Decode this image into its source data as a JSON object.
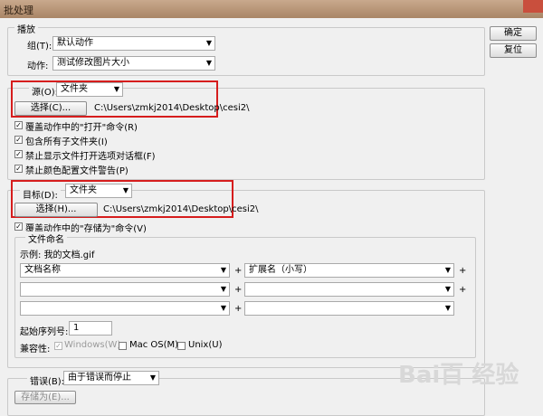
{
  "window": {
    "title": "批处理"
  },
  "buttons": {
    "ok": "确定",
    "reset": "复位"
  },
  "play": {
    "legend": "播放",
    "group_label": "组(T):",
    "group_value": "默认动作",
    "action_label": "动作:",
    "action_value": "测试修改图片大小"
  },
  "source": {
    "label": "源(O):",
    "value": "文件夹",
    "choose_button": "选择(C)...",
    "path": "C:\\Users\\zmkj2014\\Desktop\\cesi2\\",
    "options": [
      {
        "label": "覆盖动作中的\"打开\"命令(R)",
        "checked": true
      },
      {
        "label": "包含所有子文件夹(I)",
        "checked": true
      },
      {
        "label": "禁止显示文件打开选项对话框(F)",
        "checked": true
      },
      {
        "label": "禁止颜色配置文件警告(P)",
        "checked": true
      }
    ]
  },
  "target": {
    "label": "目标(D):",
    "value": "文件夹",
    "choose_button": "选择(H)...",
    "path": "C:\\Users\\zmkj2014\\Desktop\\cesi2\\",
    "override_save": {
      "label": "覆盖动作中的\"存储为\"命令(V)",
      "checked": true
    }
  },
  "naming": {
    "legend": "文件命名",
    "example": "示例: 我的文档.gif",
    "rows": [
      {
        "left": "文档名称",
        "right": "扩展名（小写）"
      },
      {
        "left": "",
        "right": ""
      },
      {
        "left": "",
        "right": ""
      }
    ],
    "plus": "+",
    "serial_label": "起始序列号:",
    "serial_value": "1",
    "compat_label": "兼容性:",
    "compat": [
      {
        "label": "Windows(W)",
        "checked": true,
        "disabled": true
      },
      {
        "label": "Mac OS(M)",
        "checked": false,
        "disabled": false
      },
      {
        "label": "Unix(U)",
        "checked": false,
        "disabled": false
      }
    ]
  },
  "errors": {
    "label": "错误(B):",
    "value": "由于错误而停止",
    "save_as_button": "存储为(E)..."
  },
  "watermark": "Bai百 经验"
}
